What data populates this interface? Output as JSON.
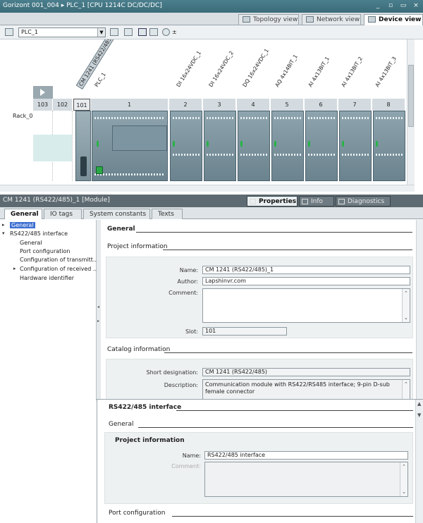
{
  "window": {
    "title": "Gorizont 001_004  ▸  PLC_1 [CPU 1214C DC/DC/DC]",
    "controls": {
      "minimize": "_",
      "restore": "▫",
      "maximize": "▭",
      "close": "×"
    }
  },
  "view_tabs": [
    {
      "label": "Topology view",
      "active": false
    },
    {
      "label": "Network view",
      "active": false
    },
    {
      "label": "Device view",
      "active": true
    }
  ],
  "toolbar": {
    "device_select": "PLC_1"
  },
  "device": {
    "rack_label": "Rack_0",
    "module_labels": [
      {
        "text": "CM 1241 (RS422/485)_1",
        "selected": true
      },
      {
        "text": "PLC_1",
        "selected": false
      },
      {
        "text": "DI 16x24VDC_1",
        "selected": false
      },
      {
        "text": "DI 16x24VDC_2",
        "selected": false
      },
      {
        "text": "DQ 16x24VDC_1",
        "selected": false
      },
      {
        "text": "AQ 4x14BIT_1",
        "selected": false
      },
      {
        "text": "AI 4x13BIT_1",
        "selected": false
      },
      {
        "text": "AI 4x13BIT_2",
        "selected": false
      },
      {
        "text": "AI 4x13BIT_3",
        "selected": false
      }
    ],
    "slots": [
      "103",
      "102",
      "101",
      "1",
      "2",
      "3",
      "4",
      "5",
      "6",
      "7",
      "8"
    ],
    "selected_slot": "101"
  },
  "inspector": {
    "title": "CM 1241 (RS422/485)_1 [Module]",
    "tabs": [
      {
        "label": "Properties",
        "active": true
      },
      {
        "label": "Info",
        "active": false
      },
      {
        "label": "Diagnostics",
        "active": false
      }
    ],
    "property_tabs": [
      {
        "label": "General",
        "active": true
      },
      {
        "label": "IO tags",
        "active": false
      },
      {
        "label": "System constants",
        "active": false
      },
      {
        "label": "Texts",
        "active": false
      }
    ],
    "tree": [
      {
        "label": "General",
        "level": 0,
        "selected": true,
        "caret": "▸"
      },
      {
        "label": "RS422/485 interface",
        "level": 0,
        "selected": false,
        "caret": "▾"
      },
      {
        "label": "General",
        "level": 1,
        "selected": false,
        "caret": ""
      },
      {
        "label": "Port configuration",
        "level": 1,
        "selected": false,
        "caret": ""
      },
      {
        "label": "Configuration of transmitt...",
        "level": 1,
        "selected": false,
        "caret": ""
      },
      {
        "label": "Configuration of received ...",
        "level": 1,
        "selected": false,
        "caret": "▸"
      },
      {
        "label": "Hardware identifier",
        "level": 1,
        "selected": false,
        "caret": ""
      }
    ],
    "general": {
      "heading": "General",
      "project_info": {
        "heading": "Project information",
        "name_label": "Name:",
        "name_value": "CM 1241 (RS422/485)_1",
        "author_label": "Author:",
        "author_value": "Lapshinvr.com",
        "comment_label": "Comment:",
        "comment_value": "",
        "slot_label": "Slot:",
        "slot_value": "101"
      },
      "catalog_info": {
        "heading": "Catalog information",
        "short_label": "Short designation:",
        "short_value": "CM 1241 (RS422/485)",
        "desc_label": "Description:",
        "desc_value": "Communication module with RS422/RS485 interface; 9-pin D-sub female connector"
      }
    }
  },
  "interface_panel": {
    "heading": "RS422/485 interface",
    "general_heading": "General",
    "project_info_heading": "Project information",
    "name_label": "Name:",
    "name_value": "RS422/485 interface",
    "comment_label": "Comment:",
    "comment_value": "",
    "port_config_heading": "Port configuration"
  }
}
